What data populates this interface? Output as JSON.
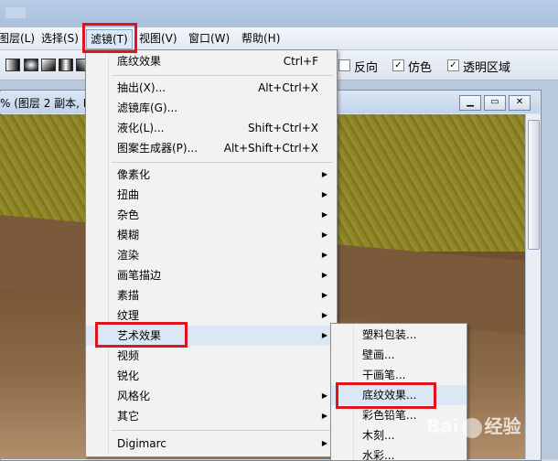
{
  "menubar": {
    "items": [
      {
        "label": "图层(L)"
      },
      {
        "label": "选择(S)"
      },
      {
        "label": "滤镜(T)"
      },
      {
        "label": "视图(V)"
      },
      {
        "label": "窗口(W)"
      },
      {
        "label": "帮助(H)"
      }
    ]
  },
  "options": {
    "reverse_label": "反向",
    "dither_label": "仿色",
    "transparency_label": "透明区域"
  },
  "document": {
    "title": "% (图层 2 副本, R"
  },
  "filter_menu": {
    "items": [
      {
        "label": "底纹效果",
        "shortcut": "Ctrl+F"
      },
      {
        "label": "抽出(X)...",
        "shortcut": "Alt+Ctrl+X"
      },
      {
        "label": "滤镜库(G)..."
      },
      {
        "label": "液化(L)...",
        "shortcut": "Shift+Ctrl+X"
      },
      {
        "label": "图案生成器(P)...",
        "shortcut": "Alt+Shift+Ctrl+X"
      },
      {
        "label": "像素化"
      },
      {
        "label": "扭曲"
      },
      {
        "label": "杂色"
      },
      {
        "label": "模糊"
      },
      {
        "label": "渲染"
      },
      {
        "label": "画笔描边"
      },
      {
        "label": "素描"
      },
      {
        "label": "纹理"
      },
      {
        "label": "艺术效果"
      },
      {
        "label": "视频"
      },
      {
        "label": "锐化"
      },
      {
        "label": "风格化"
      },
      {
        "label": "其它"
      },
      {
        "label": "Digimarc"
      }
    ]
  },
  "artistic_submenu": {
    "items": [
      {
        "label": "塑料包装..."
      },
      {
        "label": "壁画..."
      },
      {
        "label": "干画笔..."
      },
      {
        "label": "底纹效果..."
      },
      {
        "label": "彩色铅笔..."
      },
      {
        "label": "木刻..."
      },
      {
        "label": "水彩..."
      }
    ]
  },
  "colors": {
    "highlight_box": "#e0141e",
    "menu_hover": "#dce7f5"
  }
}
